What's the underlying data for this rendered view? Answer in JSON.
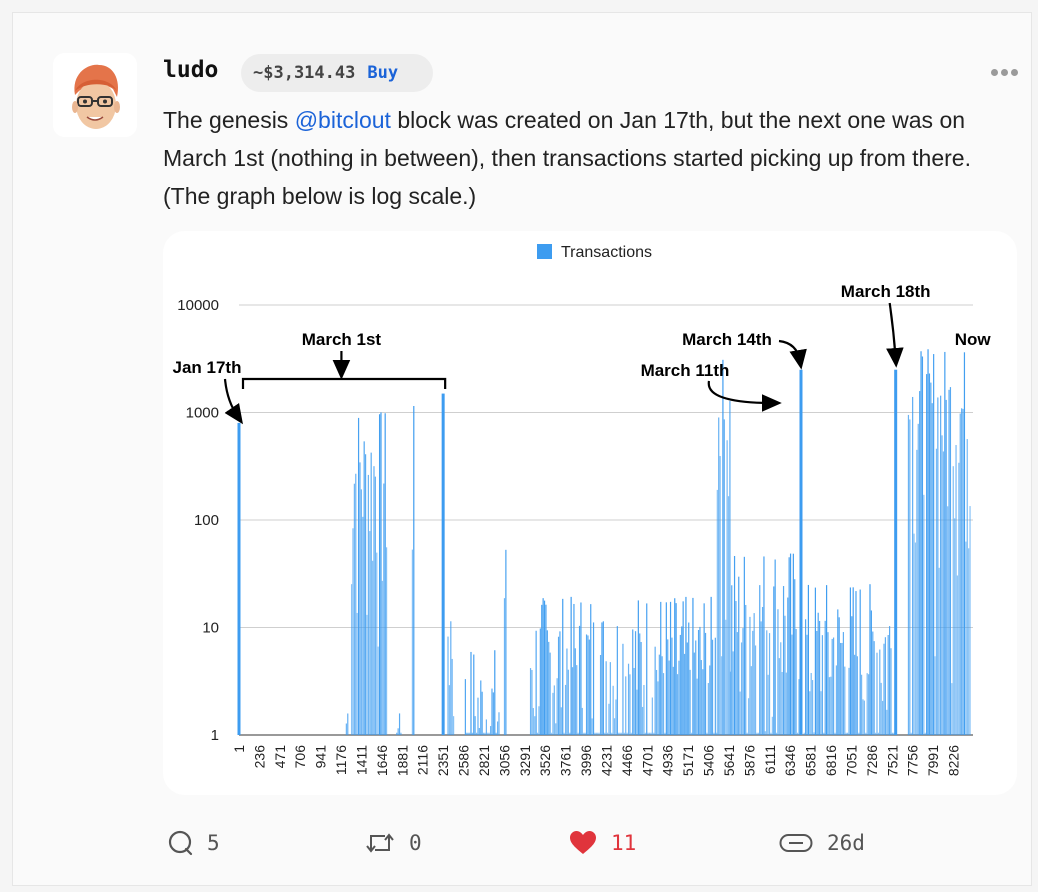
{
  "post": {
    "username": "ludo",
    "coin_price": "~$3,314.43",
    "buy_label": "Buy",
    "text_before": "The genesis ",
    "mention": "@bitclout",
    "text_after": " block was created on Jan 17th, but the next one was on March 1st (nothing in between), then transactions started picking up from there. (The graph below is log scale.)"
  },
  "actions": {
    "comments": "5",
    "reclouts": "0",
    "likes": "11",
    "age": "26d"
  },
  "colors": {
    "accent_blue": "#1b63d8",
    "bar_blue": "#3d9cf0",
    "like_red": "#e0343c"
  },
  "chart_data": {
    "type": "bar",
    "legend": [
      "Transactions"
    ],
    "legend_position": "top",
    "y_scale": "log",
    "ylim": [
      1,
      10000
    ],
    "y_ticks": [
      1,
      10,
      100,
      1000,
      10000
    ],
    "y_tick_labels": [
      "1",
      "10",
      "100",
      "1000",
      "10000"
    ],
    "x_tick_labels": [
      "1",
      "236",
      "471",
      "706",
      "941",
      "1176",
      "1411",
      "1646",
      "1881",
      "2116",
      "2351",
      "2586",
      "2821",
      "3056",
      "3291",
      "3526",
      "3761",
      "3996",
      "4231",
      "4466",
      "4701",
      "4936",
      "5171",
      "5406",
      "5641",
      "5876",
      "6111",
      "6346",
      "6581",
      "6816",
      "7051",
      "7286",
      "7521",
      "7756",
      "7991",
      "8226"
    ],
    "xlim": [
      1,
      8450
    ],
    "grid": true,
    "spikes": [
      {
        "x": 1,
        "y": 800
      },
      {
        "x": 2351,
        "y": 1500
      },
      {
        "x": 6470,
        "y": 2500
      },
      {
        "x": 7560,
        "y": 2500
      }
    ],
    "bursts": [
      {
        "from": 1230,
        "to": 1260,
        "y": 4
      },
      {
        "from": 1290,
        "to": 1700,
        "y": 800
      },
      {
        "from": 1810,
        "to": 1860,
        "y": 3
      },
      {
        "from": 1990,
        "to": 2010,
        "y": 900
      },
      {
        "from": 2400,
        "to": 2480,
        "y": 30
      },
      {
        "from": 2600,
        "to": 3000,
        "y": 5
      },
      {
        "from": 3050,
        "to": 3080,
        "y": 70
      },
      {
        "from": 3350,
        "to": 5500,
        "y": 15
      },
      {
        "from": 5500,
        "to": 5650,
        "y": 2500
      },
      {
        "from": 5650,
        "to": 6450,
        "y": 40
      },
      {
        "from": 6500,
        "to": 7540,
        "y": 20
      },
      {
        "from": 7700,
        "to": 8420,
        "y": 3000
      }
    ],
    "annotations": [
      {
        "text": "Jan 17th",
        "x": 1
      },
      {
        "text": "March 1st",
        "x": 1180
      },
      {
        "text": "March 11th",
        "x": 5480
      },
      {
        "text": "March 14th",
        "x": 6470
      },
      {
        "text": "March 18th",
        "x": 7560
      },
      {
        "text": "Now",
        "x": 8400
      }
    ]
  }
}
